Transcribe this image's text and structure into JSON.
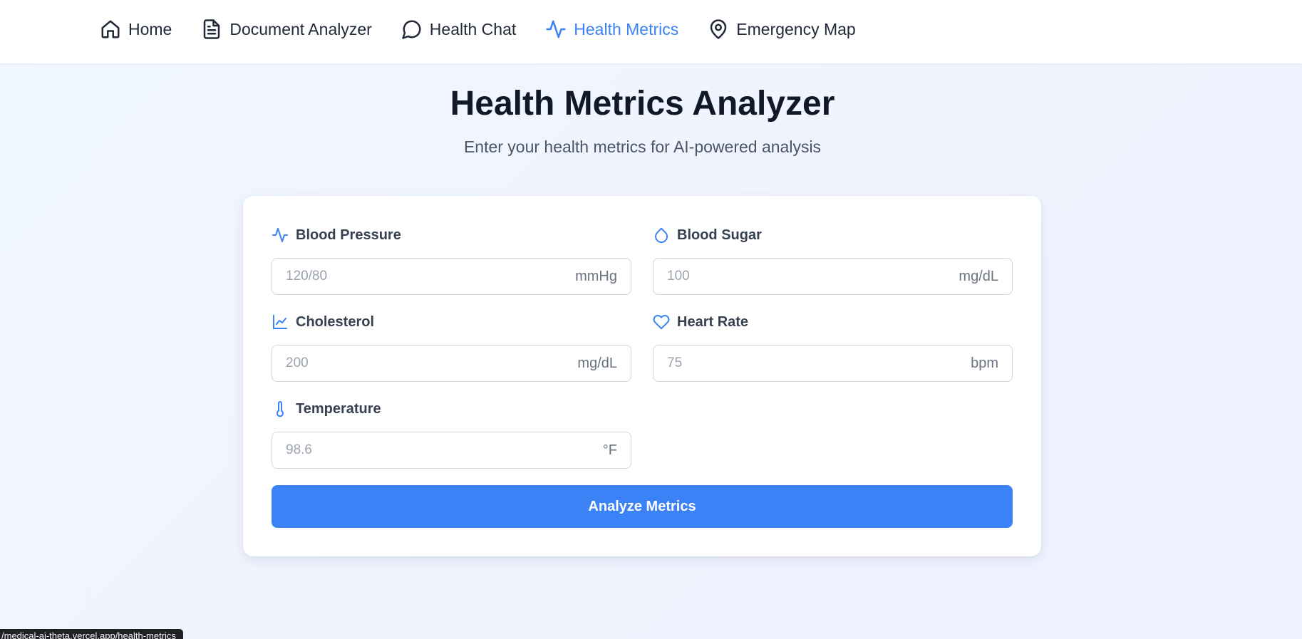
{
  "nav": {
    "items": [
      {
        "label": "Home",
        "icon": "home-icon",
        "active": false
      },
      {
        "label": "Document Analyzer",
        "icon": "document-icon",
        "active": false
      },
      {
        "label": "Health Chat",
        "icon": "chat-bubble-icon",
        "active": false
      },
      {
        "label": "Health Metrics",
        "icon": "activity-icon",
        "active": true
      },
      {
        "label": "Emergency Map",
        "icon": "map-pin-icon",
        "active": false
      }
    ],
    "active_color": "#3b82f6"
  },
  "header": {
    "title": "Health Metrics Analyzer",
    "subtitle": "Enter your health metrics for AI-powered analysis"
  },
  "form": {
    "fields": [
      {
        "label": "Blood Pressure",
        "icon": "activity-icon",
        "placeholder": "120/80",
        "value": "",
        "unit": "mmHg"
      },
      {
        "label": "Blood Sugar",
        "icon": "droplet-icon",
        "placeholder": "100",
        "value": "",
        "unit": "mg/dL"
      },
      {
        "label": "Cholesterol",
        "icon": "line-chart-icon",
        "placeholder": "200",
        "value": "",
        "unit": "mg/dL"
      },
      {
        "label": "Heart Rate",
        "icon": "heart-icon",
        "placeholder": "75",
        "value": "",
        "unit": "bpm"
      },
      {
        "label": "Temperature",
        "icon": "thermometer-icon",
        "placeholder": "98.6",
        "value": "",
        "unit": "°F"
      }
    ],
    "submit_label": "Analyze Metrics",
    "accent_color": "#3b82f6"
  },
  "status_bar": {
    "url": "/medical-ai-theta.vercel.app/health-metrics"
  }
}
